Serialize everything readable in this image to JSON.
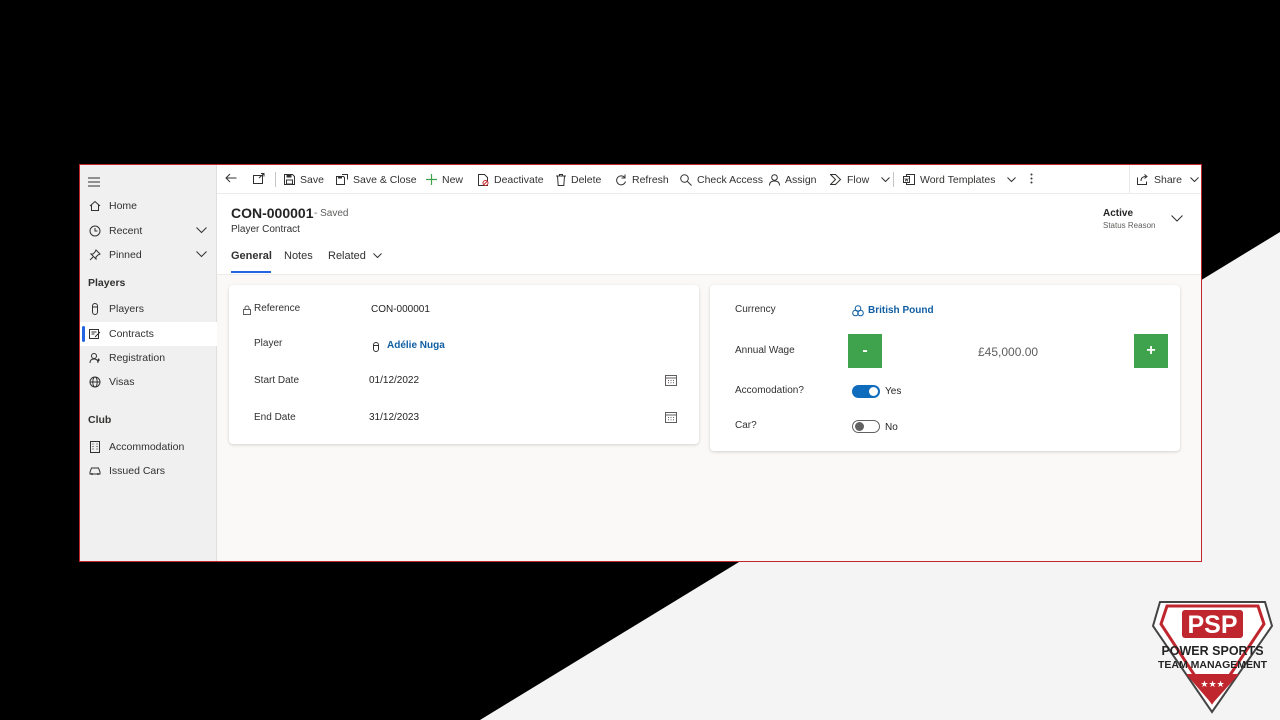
{
  "toolbar": {
    "save": "Save",
    "save_close": "Save & Close",
    "new": "New",
    "deactivate": "Deactivate",
    "delete": "Delete",
    "refresh": "Refresh",
    "check_access": "Check Access",
    "assign": "Assign",
    "flow": "Flow",
    "word_templates": "Word Templates",
    "share": "Share"
  },
  "sidebar": {
    "home": "Home",
    "recent": "Recent",
    "pinned": "Pinned",
    "group_players": "Players",
    "players": "Players",
    "contracts": "Contracts",
    "registration": "Registration",
    "visas": "Visas",
    "group_club": "Club",
    "accommodation": "Accommodation",
    "issued_cars": "Issued Cars"
  },
  "record": {
    "title": "CON-000001",
    "saved_status": "- Saved",
    "entity": "Player Contract",
    "status_value": "Active",
    "status_label": "Status Reason"
  },
  "tabs": {
    "general": "General",
    "notes": "Notes",
    "related": "Related"
  },
  "left_card": {
    "reference_label": "Reference",
    "reference_value": "CON-000001",
    "player_label": "Player",
    "player_value": "Adélie Nuga",
    "start_label": "Start Date",
    "start_value": "01/12/2022",
    "end_label": "End Date",
    "end_value": "31/12/2023"
  },
  "right_card": {
    "currency_label": "Currency",
    "currency_value": "British Pound",
    "wage_label": "Annual Wage",
    "wage_value": "£45,000.00",
    "minus": "-",
    "plus": "+",
    "accom_label": "Accomodation?",
    "accom_value": "Yes",
    "car_label": "Car?",
    "car_value": "No"
  },
  "logo": {
    "abbr": "PSP",
    "line1": "POWER SPORTS",
    "line2": "TEAM MANAGEMENT",
    "stars": "★★★"
  },
  "colors": {
    "accent": "#2266e3",
    "link": "#115ea3",
    "green_button": "#3fa34d",
    "toggle_on": "#0f6cbd",
    "frame": "#c0262d"
  }
}
